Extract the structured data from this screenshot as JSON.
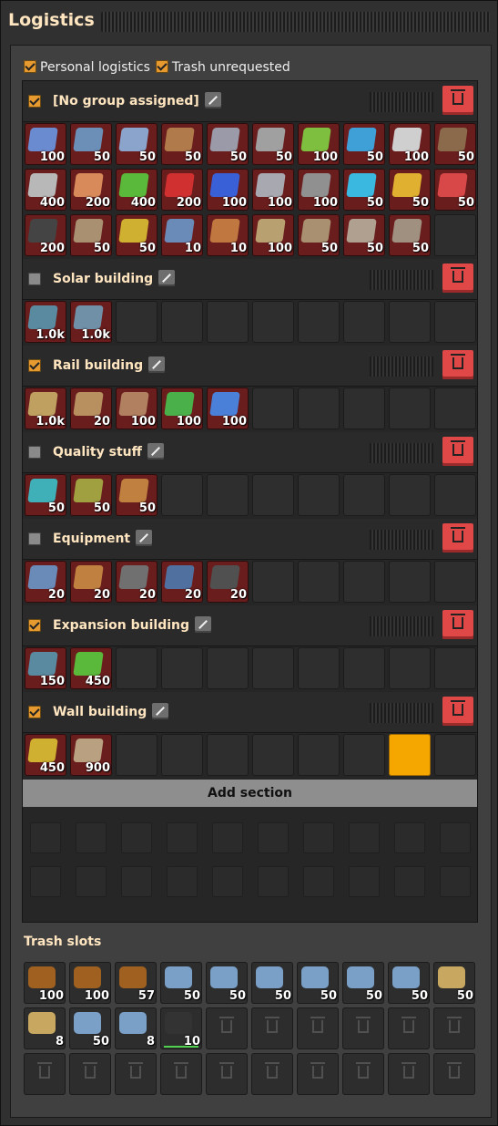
{
  "window": {
    "title": "Logistics"
  },
  "options": {
    "personal_logistics": {
      "label": "Personal logistics",
      "checked": true
    },
    "trash_unrequested": {
      "label": "Trash unrequested",
      "checked": true
    }
  },
  "sections": [
    {
      "name": "[No group assigned]",
      "enabled": true,
      "slots": [
        {
          "icon": "transport-belt-icon",
          "count": "100",
          "color": "#6a8bd0"
        },
        {
          "icon": "underground-belt-icon",
          "count": "50",
          "color": "#6c8fb8"
        },
        {
          "icon": "splitter-icon",
          "count": "50",
          "color": "#8aa4cc"
        },
        {
          "icon": "small-electric-pole-icon",
          "count": "50",
          "color": "#b07a4a"
        },
        {
          "icon": "medium-electric-pole-icon",
          "count": "50",
          "color": "#9a9aa8"
        },
        {
          "icon": "big-electric-pole-icon",
          "count": "50",
          "color": "#a0a0a0"
        },
        {
          "icon": "inserter-icon",
          "count": "100",
          "color": "#7fbf3f"
        },
        {
          "icon": "fast-inserter-icon",
          "count": "50",
          "color": "#3fa0d8"
        },
        {
          "icon": "bulk-inserter-icon",
          "count": "100",
          "color": "#cfcfcf"
        },
        {
          "icon": "wooden-chest-icon",
          "count": "50",
          "color": "#8a6a4a"
        },
        {
          "icon": "iron-plate-icon",
          "count": "400",
          "color": "#b8b8b8"
        },
        {
          "icon": "copper-plate-icon",
          "count": "200",
          "color": "#d88a5a"
        },
        {
          "icon": "electronic-circuit-icon",
          "count": "400",
          "color": "#5ab83a"
        },
        {
          "icon": "advanced-circuit-icon",
          "count": "200",
          "color": "#d03030"
        },
        {
          "icon": "processing-unit-icon",
          "count": "100",
          "color": "#3a60d8"
        },
        {
          "icon": "steel-plate-icon",
          "count": "100",
          "color": "#a8a8b0"
        },
        {
          "icon": "engine-unit-icon",
          "count": "100",
          "color": "#909090"
        },
        {
          "icon": "speed-module-icon",
          "count": "50",
          "color": "#3ab8e0"
        },
        {
          "icon": "productivity-module-icon",
          "count": "50",
          "color": "#e0b030"
        },
        {
          "icon": "efficiency-module-icon",
          "count": "50",
          "color": "#d84848"
        },
        {
          "icon": "rail-ramp-icon",
          "count": "200",
          "color": "#444444"
        },
        {
          "icon": "burner-drill-icon",
          "count": "50",
          "color": "#a89070"
        },
        {
          "icon": "assembler-icon",
          "count": "50",
          "color": "#d0b030"
        },
        {
          "icon": "electric-drill-icon",
          "count": "10",
          "color": "#6a8ab8"
        },
        {
          "icon": "furnace-icon",
          "count": "10",
          "color": "#c07840"
        },
        {
          "icon": "pipe-icon",
          "count": "100",
          "color": "#b8a070"
        },
        {
          "icon": "pipe-to-ground-icon",
          "count": "50",
          "color": "#a89070"
        },
        {
          "icon": "pump-icon",
          "count": "50",
          "color": "#b0a090"
        },
        {
          "icon": "storage-tank-icon",
          "count": "50",
          "color": "#a09080"
        },
        {
          "icon": "",
          "count": "",
          "color": ""
        }
      ]
    },
    {
      "name": "Solar building",
      "enabled": false,
      "slots": [
        {
          "icon": "solar-panel-icon",
          "count": "1.0k",
          "color": "#5a8aa0"
        },
        {
          "icon": "accumulator-icon",
          "count": "1.0k",
          "color": "#7090a8"
        },
        {
          "icon": "",
          "count": "",
          "color": ""
        },
        {
          "icon": "",
          "count": "",
          "color": ""
        },
        {
          "icon": "",
          "count": "",
          "color": ""
        },
        {
          "icon": "",
          "count": "",
          "color": ""
        },
        {
          "icon": "",
          "count": "",
          "color": ""
        },
        {
          "icon": "",
          "count": "",
          "color": ""
        },
        {
          "icon": "",
          "count": "",
          "color": ""
        },
        {
          "icon": "",
          "count": "",
          "color": ""
        }
      ]
    },
    {
      "name": "Rail building",
      "enabled": true,
      "slots": [
        {
          "icon": "rail-icon",
          "count": "1.0k",
          "color": "#c0a060"
        },
        {
          "icon": "curved-rail-icon",
          "count": "20",
          "color": "#b89060"
        },
        {
          "icon": "rail-support-icon",
          "count": "100",
          "color": "#b08060"
        },
        {
          "icon": "rail-signal-icon",
          "count": "100",
          "color": "#4ab04a"
        },
        {
          "icon": "chain-signal-icon",
          "count": "100",
          "color": "#4a80d8"
        },
        {
          "icon": "",
          "count": "",
          "color": ""
        },
        {
          "icon": "",
          "count": "",
          "color": ""
        },
        {
          "icon": "",
          "count": "",
          "color": ""
        },
        {
          "icon": "",
          "count": "",
          "color": ""
        },
        {
          "icon": "",
          "count": "",
          "color": ""
        }
      ]
    },
    {
      "name": "Quality stuff",
      "enabled": false,
      "slots": [
        {
          "icon": "quality-module-icon",
          "count": "50",
          "color": "#40b0b8"
        },
        {
          "icon": "quality-module-2-icon",
          "count": "50",
          "color": "#a0a040"
        },
        {
          "icon": "quality-module-3-icon",
          "count": "50",
          "color": "#c08040"
        },
        {
          "icon": "",
          "count": "",
          "color": ""
        },
        {
          "icon": "",
          "count": "",
          "color": ""
        },
        {
          "icon": "",
          "count": "",
          "color": ""
        },
        {
          "icon": "",
          "count": "",
          "color": ""
        },
        {
          "icon": "",
          "count": "",
          "color": ""
        },
        {
          "icon": "",
          "count": "",
          "color": ""
        },
        {
          "icon": "",
          "count": "",
          "color": ""
        }
      ]
    },
    {
      "name": "Equipment",
      "enabled": false,
      "slots": [
        {
          "icon": "personal-roboport-icon",
          "count": "20",
          "color": "#6a8ab8"
        },
        {
          "icon": "energy-shield-icon",
          "count": "20",
          "color": "#c08040"
        },
        {
          "icon": "exoskeleton-icon",
          "count": "20",
          "color": "#707070"
        },
        {
          "icon": "night-vision-icon",
          "count": "20",
          "color": "#5070a0"
        },
        {
          "icon": "battery-equipment-icon",
          "count": "20",
          "color": "#505050"
        },
        {
          "icon": "",
          "count": "",
          "color": ""
        },
        {
          "icon": "",
          "count": "",
          "color": ""
        },
        {
          "icon": "",
          "count": "",
          "color": ""
        },
        {
          "icon": "",
          "count": "",
          "color": ""
        },
        {
          "icon": "",
          "count": "",
          "color": ""
        }
      ]
    },
    {
      "name": "Expansion building",
      "enabled": true,
      "slots": [
        {
          "icon": "roboport-icon",
          "count": "150",
          "color": "#5a8aa0"
        },
        {
          "icon": "circuit-item-icon",
          "count": "450",
          "color": "#5ab83a"
        },
        {
          "icon": "",
          "count": "",
          "color": ""
        },
        {
          "icon": "",
          "count": "",
          "color": ""
        },
        {
          "icon": "",
          "count": "",
          "color": ""
        },
        {
          "icon": "",
          "count": "",
          "color": ""
        },
        {
          "icon": "",
          "count": "",
          "color": ""
        },
        {
          "icon": "",
          "count": "",
          "color": ""
        },
        {
          "icon": "",
          "count": "",
          "color": ""
        },
        {
          "icon": "",
          "count": "",
          "color": ""
        }
      ]
    },
    {
      "name": "Wall building",
      "enabled": true,
      "slots": [
        {
          "icon": "gun-turret-icon",
          "count": "450",
          "color": "#d0b030"
        },
        {
          "icon": "stone-wall-icon",
          "count": "900",
          "color": "#b8a080"
        },
        {
          "icon": "",
          "count": "",
          "color": ""
        },
        {
          "icon": "",
          "count": "",
          "color": ""
        },
        {
          "icon": "",
          "count": "",
          "color": ""
        },
        {
          "icon": "",
          "count": "",
          "color": ""
        },
        {
          "icon": "",
          "count": "",
          "color": ""
        },
        {
          "icon": "",
          "count": "",
          "color": ""
        },
        {
          "icon": "cursor",
          "count": "",
          "color": ""
        },
        {
          "icon": "",
          "count": "",
          "color": ""
        }
      ]
    }
  ],
  "add_section": {
    "label": "Add section"
  },
  "trash": {
    "title": "Trash slots",
    "slots": [
      {
        "icon": "wood-icon",
        "count": "100",
        "color": "#a06020"
      },
      {
        "icon": "wood-icon",
        "count": "100",
        "color": "#a06020"
      },
      {
        "icon": "wood-icon",
        "count": "57",
        "color": "#a06020"
      },
      {
        "icon": "iron-ore-icon",
        "count": "50",
        "color": "#7aa0c8"
      },
      {
        "icon": "iron-ore-icon",
        "count": "50",
        "color": "#7aa0c8"
      },
      {
        "icon": "iron-ore-icon",
        "count": "50",
        "color": "#7aa0c8"
      },
      {
        "icon": "iron-ore-icon",
        "count": "50",
        "color": "#7aa0c8"
      },
      {
        "icon": "iron-ore-icon",
        "count": "50",
        "color": "#7aa0c8"
      },
      {
        "icon": "iron-ore-icon",
        "count": "50",
        "color": "#7aa0c8"
      },
      {
        "icon": "stone-icon",
        "count": "50",
        "color": "#c8a860"
      },
      {
        "icon": "stone-icon",
        "count": "8",
        "color": "#c8a860"
      },
      {
        "icon": "iron-ore-icon",
        "count": "50",
        "color": "#7aa0c8"
      },
      {
        "icon": "iron-ore-icon",
        "count": "8",
        "color": "#7aa0c8"
      },
      {
        "icon": "rail-ramp-icon",
        "count": "10",
        "color": "#333333"
      },
      {
        "icon": "",
        "count": "",
        "color": ""
      },
      {
        "icon": "",
        "count": "",
        "color": ""
      },
      {
        "icon": "",
        "count": "",
        "color": ""
      },
      {
        "icon": "",
        "count": "",
        "color": ""
      },
      {
        "icon": "",
        "count": "",
        "color": ""
      },
      {
        "icon": "",
        "count": "",
        "color": ""
      },
      {
        "icon": "",
        "count": "",
        "color": ""
      },
      {
        "icon": "",
        "count": "",
        "color": ""
      },
      {
        "icon": "",
        "count": "",
        "color": ""
      },
      {
        "icon": "",
        "count": "",
        "color": ""
      },
      {
        "icon": "",
        "count": "",
        "color": ""
      },
      {
        "icon": "",
        "count": "",
        "color": ""
      },
      {
        "icon": "",
        "count": "",
        "color": ""
      },
      {
        "icon": "",
        "count": "",
        "color": ""
      },
      {
        "icon": "",
        "count": "",
        "color": ""
      },
      {
        "icon": "",
        "count": "",
        "color": ""
      }
    ]
  }
}
